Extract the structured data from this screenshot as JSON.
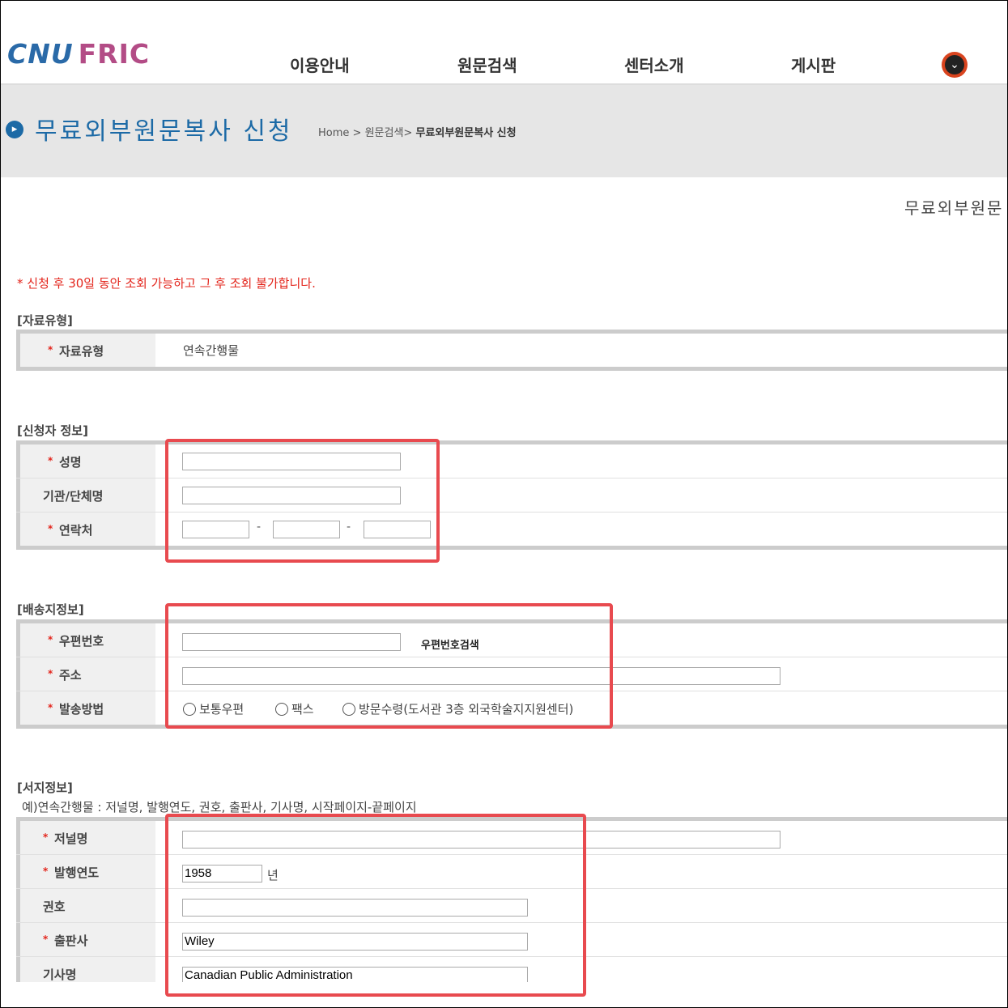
{
  "header": {
    "logo_part1": "CNU",
    "logo_part2": "FRIC",
    "nav": [
      "이용안내",
      "원문검색",
      "센터소개",
      "게시판"
    ],
    "more_icon": "chevron-down-icon"
  },
  "titleband": {
    "icon": "arrow-right-icon",
    "title": "무료외부원문복사 신청",
    "breadcrumb": {
      "home": "Home",
      "sep1": ">",
      "section": "원문검색",
      "sep2": ">",
      "current": "무료외부원문복사 신청"
    }
  },
  "right_cut_title": "무료외부원문",
  "notice": "* 신청 후 30일 동안 조회 가능하고 그 후 조회 불가합니다.",
  "sections": {
    "material_type": {
      "label": "[자료유형]",
      "field_label": "자료유형",
      "value": "연속간행물"
    },
    "applicant": {
      "label": "[신청자 정보]",
      "name_label": "성명",
      "org_label": "기관/단체명",
      "phone_label": "연락처",
      "name_value": "",
      "org_value": "",
      "phone_values": [
        "",
        "",
        ""
      ],
      "dash": "-"
    },
    "delivery": {
      "label": "[배송지정보]",
      "zip_label": "우편번호",
      "zip_value": "",
      "zip_search": "우편번호검색",
      "address_label": "주소",
      "address_value": "",
      "method_label": "발송방법",
      "methods": [
        "보통우편",
        "팩스",
        "방문수령(도서관 3층 외국학술지지원센터)"
      ]
    },
    "bibliography": {
      "label": "[서지정보]",
      "hint": "예)연속간행물 : 저널명, 발행연도, 권호, 출판사, 기사명, 시작페이지-끝페이지",
      "journal_label": "저널명",
      "journal_value": "",
      "year_label": "발행연도",
      "year_value": "1958",
      "year_unit": "년",
      "volume_label": "권호",
      "volume_value": "",
      "publisher_label": "출판사",
      "publisher_value": "Wiley",
      "article_label": "기사명",
      "article_value": "Canadian Public Administration"
    }
  },
  "colors": {
    "brand_blue": "#1c6aa6",
    "brand_pink": "#b34c86",
    "required_red": "#e3241b",
    "highlight_red": "#e84a4f"
  }
}
